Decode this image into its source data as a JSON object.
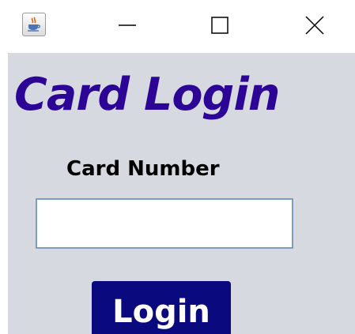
{
  "window": {
    "icon": "java-cup-icon",
    "controls": [
      "minimize-icon",
      "maximize-icon",
      "close-icon"
    ]
  },
  "content": {
    "title": "Card Login",
    "card_number_label": "Card Number",
    "card_number_value": "",
    "login_label": "Login"
  },
  "colors": {
    "background": "#d6d9e0",
    "title": "#2c0597",
    "button": "#0a0a7e",
    "input_border": "#7b9ebd"
  }
}
